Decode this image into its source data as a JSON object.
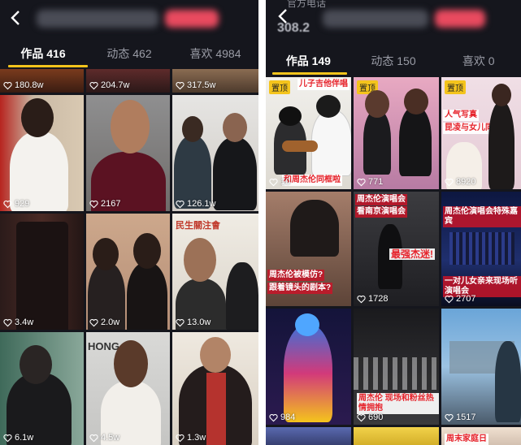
{
  "left": {
    "tabs": [
      {
        "label": "作品 416",
        "active": true
      },
      {
        "label": "动态 462",
        "active": false
      },
      {
        "label": "喜欢 4984",
        "active": false
      }
    ],
    "likes": [
      "180.8w",
      "204.7w",
      "317.5w",
      "929",
      "2167",
      "126.1w",
      "3.4w",
      "2.0w",
      "13.0w",
      "6.1w",
      "4.5w",
      "1.3w"
    ]
  },
  "right": {
    "peek_label": "官方电话",
    "peek_number": "308.2",
    "tabs": [
      {
        "label": "作品 149",
        "active": true
      },
      {
        "label": "动态 150",
        "active": false
      },
      {
        "label": "喜欢 0",
        "active": false
      }
    ],
    "pin_label": "置顶",
    "likes": [
      "10",
      "771",
      "8920",
      "",
      "1728",
      "2707",
      "984",
      "690",
      "1517"
    ],
    "overlays": {
      "c1_top": "儿子吉他伴唱",
      "c1_bottom": "和周杰伦同框啦",
      "c2_top": "周杰伦演唱会",
      "c2_bottom": "看南京演唱会",
      "c2_mid": "最强杰迷!",
      "c3_top": "周杰伦演唱会特殊嘉宾",
      "c3_bottom": "一对儿女亲来现场听演唱会",
      "c4_line1": "周杰伦被模仿?",
      "c4_line2": "跟着镜头的剧本?",
      "c5_bottom": "周杰伦 现场和粉丝热情拥抱",
      "c6_top": "人气写真",
      "c6_bottom": "昆凌与女儿同框",
      "c7_bottom": "周末家庭日"
    }
  },
  "colors": {
    "accent": "#f4c41c",
    "bg": "#15161d"
  }
}
